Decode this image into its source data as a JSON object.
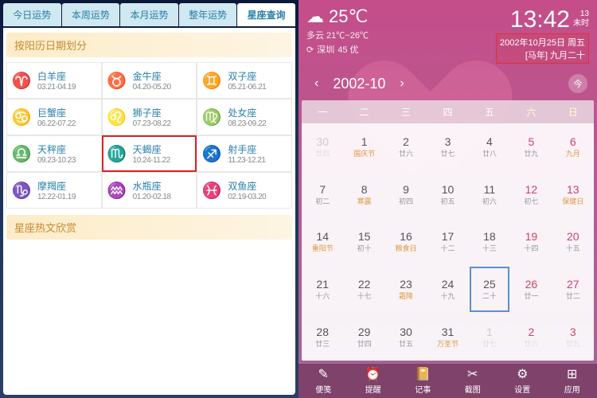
{
  "left": {
    "tabs": [
      "今日运势",
      "本周运势",
      "本月运势",
      "整年运势",
      "星座查询"
    ],
    "active_tab": 4,
    "section1_title": "按阳历日期划分",
    "section2_title": "星座热文欣赏",
    "zodiac": [
      {
        "sym": "♈",
        "name": "白羊座",
        "range": "03.21-04.19"
      },
      {
        "sym": "♉",
        "name": "金牛座",
        "range": "04.20-05.20"
      },
      {
        "sym": "♊",
        "name": "双子座",
        "range": "05.21-06.21"
      },
      {
        "sym": "♋",
        "name": "巨蟹座",
        "range": "06.22-07.22"
      },
      {
        "sym": "♌",
        "name": "狮子座",
        "range": "07.23-08.22"
      },
      {
        "sym": "♍",
        "name": "处女座",
        "range": "08.23-09.22"
      },
      {
        "sym": "♎",
        "name": "天秤座",
        "range": "09.23-10.23"
      },
      {
        "sym": "♏",
        "name": "天蝎座",
        "range": "10.24-11.22"
      },
      {
        "sym": "♐",
        "name": "射手座",
        "range": "11.23-12.21"
      },
      {
        "sym": "♑",
        "name": "摩羯座",
        "range": "12.22-01.19"
      },
      {
        "sym": "♒",
        "name": "水瓶座",
        "range": "01.20-02.18"
      },
      {
        "sym": "♓",
        "name": "双鱼座",
        "range": "02.19-03.20"
      }
    ],
    "selected_zodiac": 7
  },
  "right": {
    "weather": {
      "icon": "☁",
      "temp": "25℃",
      "cond_range": "多云 21℃~26℃",
      "refresh_icon": "⟳",
      "city": "深圳",
      "aqi": "45 优"
    },
    "clock": {
      "time": "13:42",
      "hour_num": "13",
      "hour_label": "未时",
      "date_line1": "2002年10月25日 周五",
      "date_line2": "[马年] 九月二十"
    },
    "month_nav": {
      "prev": "‹",
      "label": "2002-10",
      "next": "›",
      "today": "今"
    },
    "dow": [
      "一",
      "二",
      "三",
      "四",
      "五",
      "六",
      "日"
    ],
    "days": [
      {
        "n": "30",
        "s": "廿四",
        "dim": true
      },
      {
        "n": "1",
        "s": "国庆节",
        "hol": true
      },
      {
        "n": "2",
        "s": "廿六"
      },
      {
        "n": "3",
        "s": "廿七"
      },
      {
        "n": "4",
        "s": "廿八"
      },
      {
        "n": "5",
        "s": "廿九",
        "wknd": true
      },
      {
        "n": "6",
        "s": "九月",
        "wknd": true,
        "hol": true
      },
      {
        "n": "7",
        "s": "初二"
      },
      {
        "n": "8",
        "s": "寒露",
        "hol": true
      },
      {
        "n": "9",
        "s": "初四"
      },
      {
        "n": "10",
        "s": "初五"
      },
      {
        "n": "11",
        "s": "初六"
      },
      {
        "n": "12",
        "s": "初七",
        "wknd": true
      },
      {
        "n": "13",
        "s": "保健日",
        "wknd": true,
        "hol": true
      },
      {
        "n": "14",
        "s": "重阳节",
        "hol": true
      },
      {
        "n": "15",
        "s": "初十"
      },
      {
        "n": "16",
        "s": "粮食日",
        "hol": true
      },
      {
        "n": "17",
        "s": "十二"
      },
      {
        "n": "18",
        "s": "十三"
      },
      {
        "n": "19",
        "s": "十四",
        "wknd": true
      },
      {
        "n": "20",
        "s": "十五",
        "wknd": true
      },
      {
        "n": "21",
        "s": "十六"
      },
      {
        "n": "22",
        "s": "十七"
      },
      {
        "n": "23",
        "s": "霜降",
        "hol": true
      },
      {
        "n": "24",
        "s": "十九"
      },
      {
        "n": "25",
        "s": "二十",
        "sel": true
      },
      {
        "n": "26",
        "s": "廿一",
        "wknd": true
      },
      {
        "n": "27",
        "s": "廿二",
        "wknd": true
      },
      {
        "n": "28",
        "s": "廿三"
      },
      {
        "n": "29",
        "s": "廿四"
      },
      {
        "n": "30",
        "s": "廿五"
      },
      {
        "n": "31",
        "s": "万圣节",
        "hol": true
      },
      {
        "n": "1",
        "s": "廿七",
        "dim": true
      },
      {
        "n": "2",
        "s": "廿八",
        "dim": true,
        "wknd": true
      },
      {
        "n": "3",
        "s": "廿九",
        "dim": true,
        "wknd": true
      }
    ],
    "bottom": [
      {
        "icon": "✎",
        "label": "便笺"
      },
      {
        "icon": "⏰",
        "label": "提醒"
      },
      {
        "icon": "📔",
        "label": "记事"
      },
      {
        "icon": "✂",
        "label": "截图"
      },
      {
        "icon": "⚙",
        "label": "设置"
      },
      {
        "icon": "⊞",
        "label": "应用"
      }
    ]
  }
}
